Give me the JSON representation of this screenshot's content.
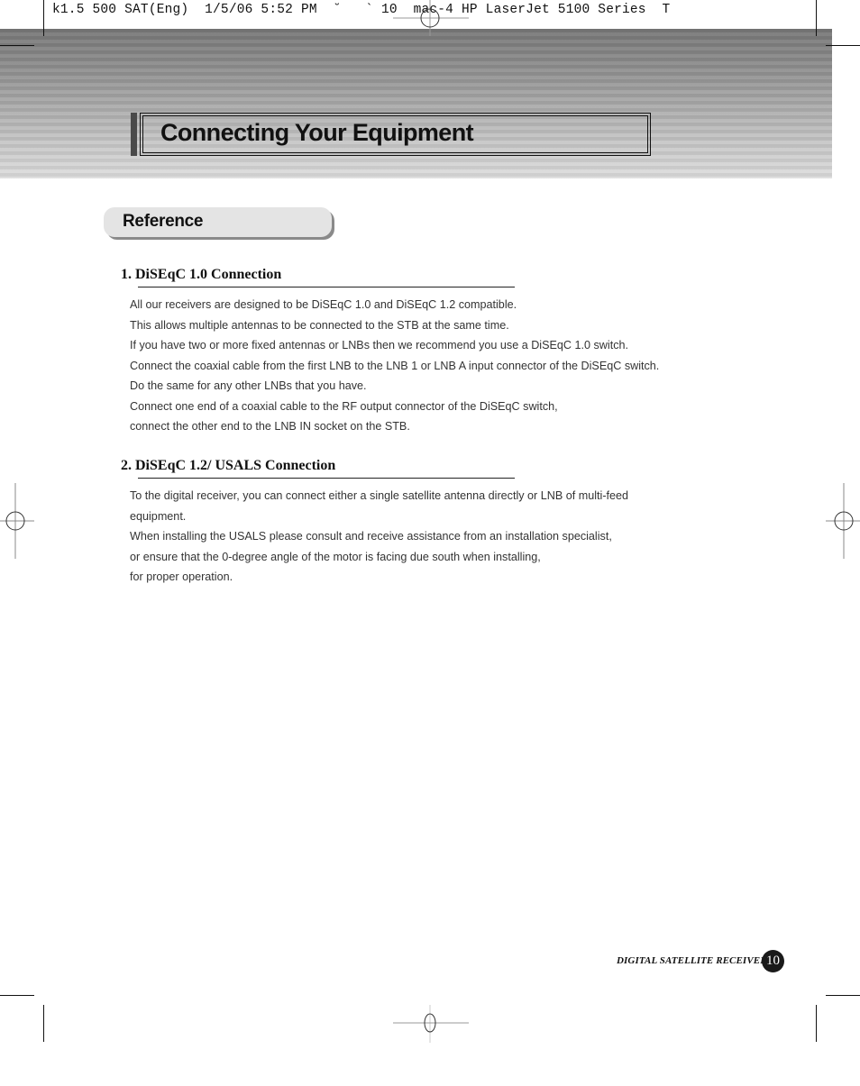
{
  "print_slug": "k1.5 500 SAT(Eng)  1/5/06 5:52 PM  ˘   ` 10  mac-4 HP LaserJet 5100 Series  T",
  "header": {
    "title": "Connecting Your Equipment"
  },
  "section_tab": {
    "label": "Reference"
  },
  "sections": [
    {
      "heading": "1. DiSEqC 1.0 Connection",
      "lines": [
        "All our receivers are designed to be DiSEqC 1.0 and DiSEqC 1.2 compatible.",
        "This allows multiple antennas to be connected to the STB at the same time.",
        "If you have two or more fixed antennas or LNBs then we recommend you use a DiSEqC 1.0 switch.",
        "Connect the coaxial cable from the first LNB to the LNB 1 or LNB A input connector of the DiSEqC switch.",
        "Do the same for any other LNBs that you have.",
        "Connect one end of a coaxial cable to the RF output connector of the DiSEqC switch,",
        "connect the other end to the LNB IN socket on the STB."
      ]
    },
    {
      "heading": "2. DiSEqC 1.2/ USALS Connection",
      "lines": [
        "To the digital receiver, you can connect either a single satellite antenna directly or LNB of multi-feed",
        "equipment.",
        "When installing the USALS please consult and receive assistance from an installation specialist,",
        "or ensure that the 0-degree angle of the motor is facing due south when installing,",
        "for proper operation."
      ]
    }
  ],
  "footer": {
    "product": "DIGITAL SATELLITE RECEIVER",
    "page_number": "10"
  }
}
